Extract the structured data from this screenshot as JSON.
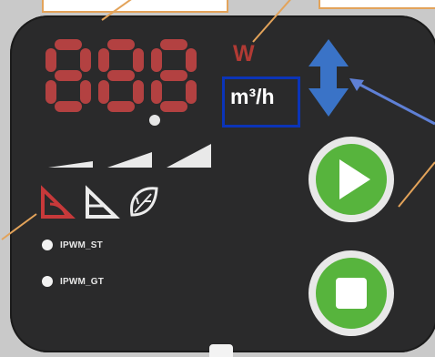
{
  "display": {
    "seven_segment_digits": [
      "8",
      "8",
      "8"
    ],
    "segment_color": "#b34141",
    "decimal_point_color": "#e6e6e6"
  },
  "units": {
    "power_unit": "W",
    "flow_unit": "m³/h",
    "power_unit_color": "#b13a34",
    "flow_box_border_color": "#0b34b8"
  },
  "speed_levels": {
    "count": 3,
    "color": "#e9e9e9"
  },
  "mode_icons": [
    {
      "name": "pressure-mode-red",
      "color": "#c7393a"
    },
    {
      "name": "pressure-mode-white",
      "color": "#ececec"
    },
    {
      "name": "eco-leaf",
      "color": "#ececec"
    }
  ],
  "indicators": [
    {
      "label": "IPWM_ST"
    },
    {
      "label": "IPWM_GT"
    }
  ],
  "buttons": {
    "play": {
      "icon": "play-icon",
      "color": "#57b43d"
    },
    "stop": {
      "icon": "stop-icon",
      "color": "#57b43d"
    }
  },
  "updown": {
    "icon": "up-down-arrow-icon",
    "color": "#3a73c7"
  },
  "annotation_colors": {
    "orange": "#e3a35a",
    "blue_line": "#5f80d6"
  }
}
